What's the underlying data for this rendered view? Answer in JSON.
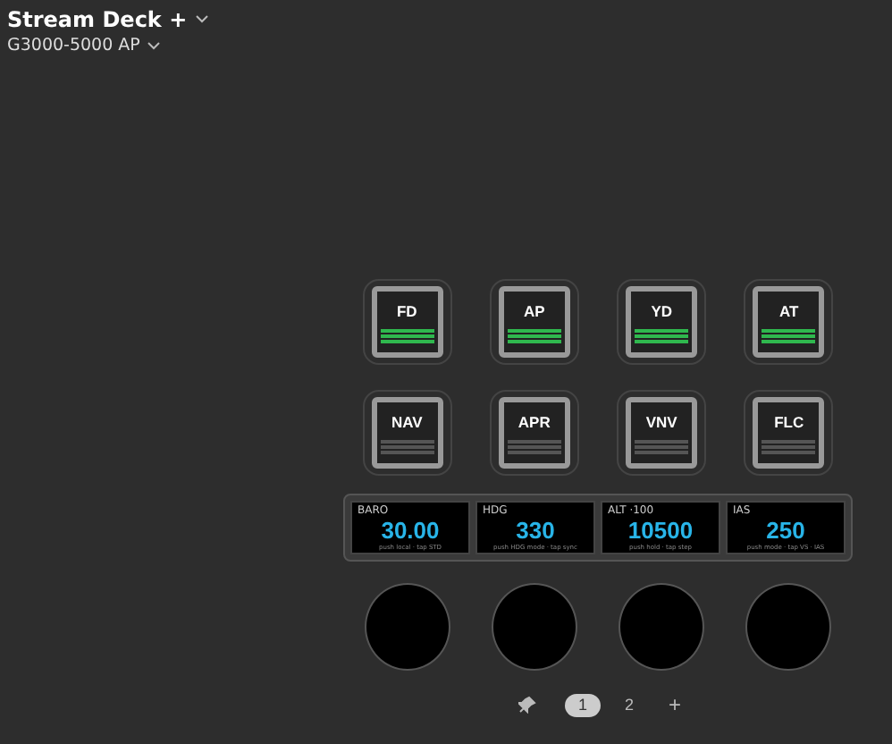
{
  "device": {
    "name": "Stream Deck +",
    "profile": "G3000-5000 AP"
  },
  "keys": [
    {
      "label": "FD",
      "on": true
    },
    {
      "label": "AP",
      "on": true
    },
    {
      "label": "YD",
      "on": true
    },
    {
      "label": "AT",
      "on": true
    },
    {
      "label": "NAV",
      "on": false
    },
    {
      "label": "APR",
      "on": false
    },
    {
      "label": "VNV",
      "on": false
    },
    {
      "label": "FLC",
      "on": false
    }
  ],
  "touch_strip": [
    {
      "title": "BARO",
      "value": "30.00",
      "hint": "push local · tap STD"
    },
    {
      "title": "HDG",
      "value": "330",
      "hint": "push HDG mode · tap sync"
    },
    {
      "title": "ALT ·100",
      "value": "10500",
      "hint": "push hold · tap step"
    },
    {
      "title": "IAS",
      "value": "250",
      "hint": "push mode · tap VS · IAS"
    }
  ],
  "pages": [
    {
      "label": "1",
      "selected": true
    },
    {
      "label": "2",
      "selected": false
    }
  ],
  "add_page": "+"
}
